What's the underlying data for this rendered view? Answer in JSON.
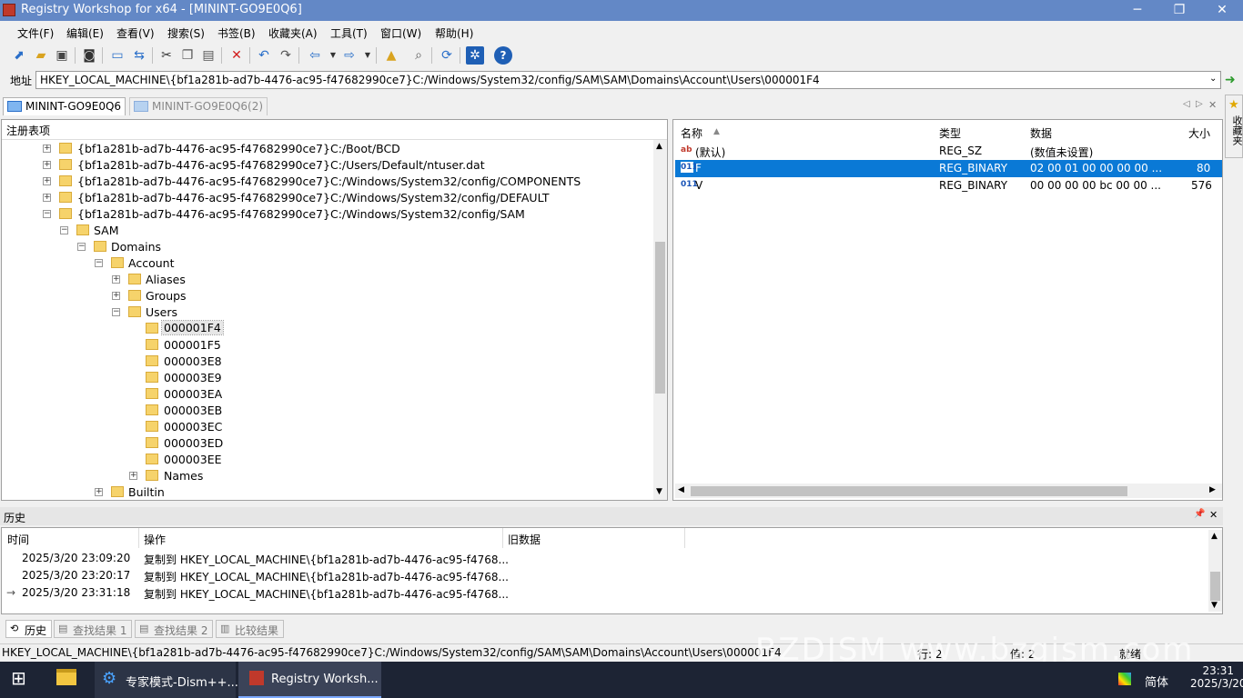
{
  "window": {
    "title": "Registry Workshop for x64 - [MININT-GO9E0Q6]",
    "min": "─",
    "max": "❐",
    "close": "✕"
  },
  "menu": [
    "文件(F)",
    "编辑(E)",
    "查看(V)",
    "搜索(S)",
    "书签(B)",
    "收藏夹(A)",
    "工具(T)",
    "窗口(W)",
    "帮助(H)"
  ],
  "address": {
    "label": "地址",
    "value": "HKEY_LOCAL_MACHINE\\{bf1a281b-ad7b-4476-ac95-f47682990ce7}C:/Windows/System32/config/SAM\\SAM\\Domains\\Account\\Users\\000001F4"
  },
  "tabs": [
    "MININT-GO9E0Q6",
    "MININT-GO9E0Q6(2)"
  ],
  "tree": {
    "header": "注册表项",
    "rows": [
      "{bf1a281b-ad7b-4476-ac95-f47682990ce7}C:/Boot/BCD",
      "{bf1a281b-ad7b-4476-ac95-f47682990ce7}C:/Users/Default/ntuser.dat",
      "{bf1a281b-ad7b-4476-ac95-f47682990ce7}C:/Windows/System32/config/COMPONENTS",
      "{bf1a281b-ad7b-4476-ac95-f47682990ce7}C:/Windows/System32/config/DEFAULT",
      "{bf1a281b-ad7b-4476-ac95-f47682990ce7}C:/Windows/System32/config/SAM",
      "SAM",
      "Domains",
      "Account",
      "Aliases",
      "Groups",
      "Users",
      "000001F4",
      "000001F5",
      "000003E8",
      "000003E9",
      "000003EA",
      "000003EB",
      "000003EC",
      "000003ED",
      "000003EE",
      "Names",
      "Builtin"
    ]
  },
  "values": {
    "headers": {
      "name": "名称",
      "type": "类型",
      "data": "数据",
      "size": "大小"
    },
    "rows": [
      {
        "icon": "ab",
        "name": "(默认)",
        "type": "REG_SZ",
        "data": "(数值未设置)",
        "size": ""
      },
      {
        "icon": "011",
        "name": "F",
        "type": "REG_BINARY",
        "data": "02 00 01 00 00 00 00 ...",
        "size": "80"
      },
      {
        "icon": "011",
        "name": "V",
        "type": "REG_BINARY",
        "data": "00 00 00 00 bc 00 00 ...",
        "size": "576"
      }
    ]
  },
  "favorites": "收藏夹",
  "history": {
    "title": "历史",
    "pin": "📌",
    "close": "✕",
    "headers": {
      "time": "时间",
      "op": "操作",
      "old": "旧数据"
    },
    "rows": [
      {
        "time": "2025/3/20 23:09:20",
        "op": "复制到 HKEY_LOCAL_MACHINE\\{bf1a281b-ad7b-4476-ac95-f4768..."
      },
      {
        "time": "2025/3/20 23:20:17",
        "op": "复制到 HKEY_LOCAL_MACHINE\\{bf1a281b-ad7b-4476-ac95-f4768..."
      },
      {
        "time": "2025/3/20 23:31:18",
        "op": "复制到 HKEY_LOCAL_MACHINE\\{bf1a281b-ad7b-4476-ac95-f4768..."
      }
    ]
  },
  "bottom_tabs": [
    "历史",
    "查找结果 1",
    "查找结果 2",
    "比较结果"
  ],
  "status": {
    "path": "HKEY_LOCAL_MACHINE\\{bf1a281b-ad7b-4476-ac95-f47682990ce7}C:/Windows/System32/config/SAM\\SAM\\Domains\\Account\\Users\\000001F4",
    "row": "行: 2",
    "val": "值: 2",
    "ready": "就绪"
  },
  "taskbar": {
    "items": [
      "专家模式-Dism++...",
      "Registry Worksh..."
    ],
    "ime": "简体",
    "time": "23:31",
    "date": "2025/3/20"
  },
  "watermark": "BZDJSM www.bzgjsm.com"
}
